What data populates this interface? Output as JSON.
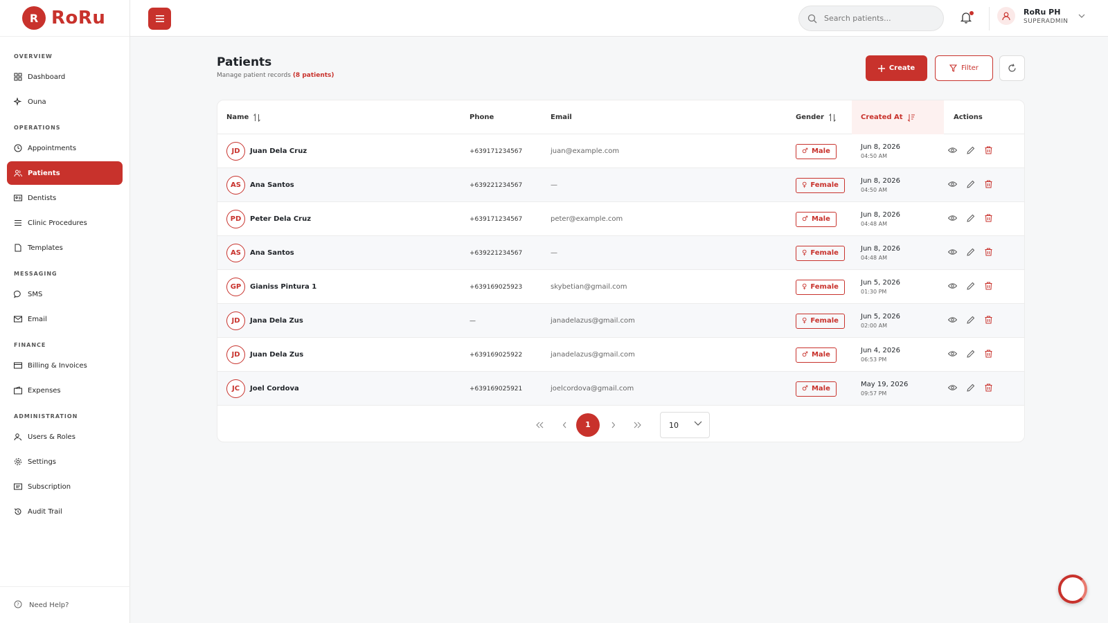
{
  "brand": {
    "name": "RoRu",
    "logo_letter": "R",
    "accent": "#c8322c"
  },
  "sidebar": {
    "sections": [
      {
        "title": "OVERVIEW",
        "items": [
          {
            "label": "Dashboard",
            "icon": "grid-icon"
          },
          {
            "label": "Ouna",
            "icon": "sparkle-icon"
          }
        ]
      },
      {
        "title": "OPERATIONS",
        "items": [
          {
            "label": "Appointments",
            "icon": "clock-icon"
          },
          {
            "label": "Patients",
            "icon": "users-icon",
            "active": true
          },
          {
            "label": "Dentists",
            "icon": "id-card-icon"
          },
          {
            "label": "Clinic Procedures",
            "icon": "list-icon"
          },
          {
            "label": "Templates",
            "icon": "file-icon"
          }
        ]
      },
      {
        "title": "MESSAGING",
        "items": [
          {
            "label": "SMS",
            "icon": "chat-icon"
          },
          {
            "label": "Email",
            "icon": "mail-icon"
          }
        ]
      },
      {
        "title": "FINANCE",
        "items": [
          {
            "label": "Billing & Invoices",
            "icon": "card-icon"
          },
          {
            "label": "Expenses",
            "icon": "wallet-icon"
          }
        ]
      },
      {
        "title": "ADMINISTRATION",
        "items": [
          {
            "label": "Users & Roles",
            "icon": "user-key-icon"
          },
          {
            "label": "Settings",
            "icon": "gear-icon"
          },
          {
            "label": "Subscription",
            "icon": "receipt-icon"
          },
          {
            "label": "Audit Trail",
            "icon": "history-icon"
          }
        ]
      }
    ],
    "help_label": "Need Help?"
  },
  "topbar": {
    "search_placeholder": "Search patients...",
    "user_name": "RoRu PH",
    "user_role": "SUPERADMIN"
  },
  "page": {
    "title": "Patients",
    "subtitle": "Manage patient records",
    "count_text": "(8 patients)",
    "create_label": "Create",
    "filter_label": "Filter"
  },
  "table": {
    "headers": {
      "name": "Name",
      "phone": "Phone",
      "email": "Email",
      "gender": "Gender",
      "created_at": "Created At",
      "actions": "Actions"
    },
    "rows": [
      {
        "initials": "JD",
        "name": "Juan Dela Cruz",
        "phone": "+639171234567",
        "email": "juan@example.com",
        "gender": "Male",
        "date": "Jun 8, 2026",
        "time": "04:50 AM"
      },
      {
        "initials": "AS",
        "name": "Ana Santos",
        "phone": "+639221234567",
        "email": "—",
        "gender": "Female",
        "date": "Jun 8, 2026",
        "time": "04:50 AM"
      },
      {
        "initials": "PD",
        "name": "Peter Dela Cruz",
        "phone": "+639171234567",
        "email": "peter@example.com",
        "gender": "Male",
        "date": "Jun 8, 2026",
        "time": "04:48 AM"
      },
      {
        "initials": "AS",
        "name": "Ana Santos",
        "phone": "+639221234567",
        "email": "—",
        "gender": "Female",
        "date": "Jun 8, 2026",
        "time": "04:48 AM"
      },
      {
        "initials": "GP",
        "name": "Gianiss Pintura 1",
        "phone": "+639169025923",
        "email": "skybetian@gmail.com",
        "gender": "Female",
        "date": "Jun 5, 2026",
        "time": "01:30 PM"
      },
      {
        "initials": "JD",
        "name": "Jana Dela Zus",
        "phone": "—",
        "email": "janadelazus@gmail.com",
        "gender": "Female",
        "date": "Jun 5, 2026",
        "time": "02:00 AM"
      },
      {
        "initials": "JD",
        "name": "Juan Dela Zus",
        "phone": "+639169025922",
        "email": "janadelazus@gmail.com",
        "gender": "Male",
        "date": "Jun 4, 2026",
        "time": "06:53 PM"
      },
      {
        "initials": "JC",
        "name": "Joel Cordova",
        "phone": "+639169025921",
        "email": "joelcordova@gmail.com",
        "gender": "Male",
        "date": "May 19, 2026",
        "time": "09:57 PM"
      }
    ]
  },
  "pagination": {
    "current_page": "1",
    "page_size": "10"
  }
}
